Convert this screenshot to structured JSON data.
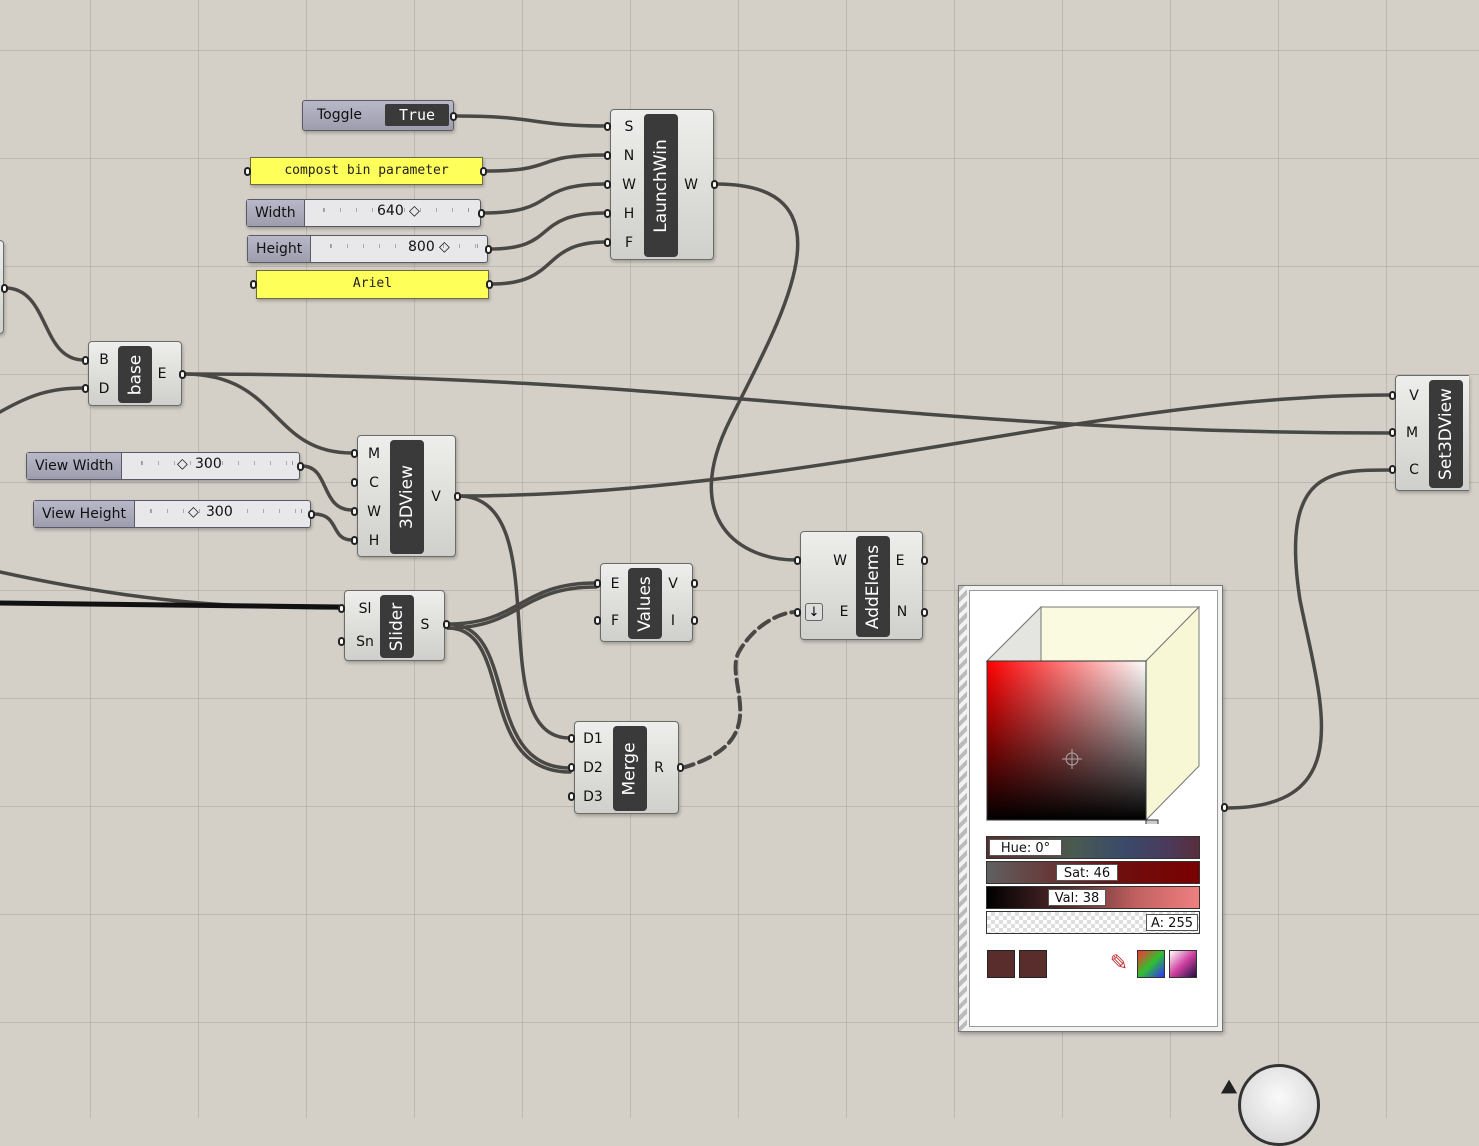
{
  "components": {
    "toggle": {
      "label": "Toggle",
      "value": "True"
    },
    "panel_name": {
      "text": "compost bin parameter"
    },
    "slider_width": {
      "label": "Width",
      "value": "640"
    },
    "slider_height": {
      "label": "Height",
      "value": "800"
    },
    "panel_font": {
      "text": "Ariel"
    },
    "launchwin": {
      "name": "LaunchWin",
      "inputs": [
        "S",
        "N",
        "W",
        "H",
        "F"
      ],
      "outputs": [
        "W"
      ]
    },
    "base": {
      "name": "base",
      "inputs": [
        "B",
        "D"
      ],
      "outputs": [
        "E"
      ]
    },
    "view_width": {
      "label": "View Width",
      "value": "300"
    },
    "view_height": {
      "label": "View Height",
      "value": "300"
    },
    "view3d": {
      "name": "3DView",
      "inputs": [
        "M",
        "C",
        "W",
        "H"
      ],
      "outputs": [
        "V"
      ]
    },
    "slider_comp": {
      "name": "Slider",
      "inputs": [
        "Sl",
        "Sn"
      ],
      "outputs": [
        "S"
      ]
    },
    "values": {
      "name": "Values",
      "inputs": [
        "E",
        "F"
      ],
      "outputs": [
        "V",
        "I"
      ]
    },
    "merge": {
      "name": "Merge",
      "inputs": [
        "D1",
        "D2",
        "D3"
      ],
      "outputs": [
        "R"
      ]
    },
    "addelems": {
      "name": "AddElems",
      "inputs": [
        "W",
        "E"
      ],
      "outputs": [
        "E",
        "N"
      ]
    },
    "set3dview": {
      "name": "Set3DView",
      "inputs": [
        "V",
        "M",
        "C"
      ]
    }
  },
  "color_picker": {
    "hue_label": "Hue: 0°",
    "sat_label": "Sat: 46",
    "val_label": "Val: 38",
    "alpha_label": "A: 255",
    "current_color": "#5a2d2d",
    "icons": [
      "eyedropper-icon",
      "rgb-cube-icon",
      "gradient-swatch-icon"
    ]
  },
  "colors": {
    "canvas": "#d4d0c8",
    "component_body": "#e6e6e4",
    "component_name": "#3a3a3a",
    "panel_yellow": "#ffff5a",
    "wire": "#4a4845"
  }
}
